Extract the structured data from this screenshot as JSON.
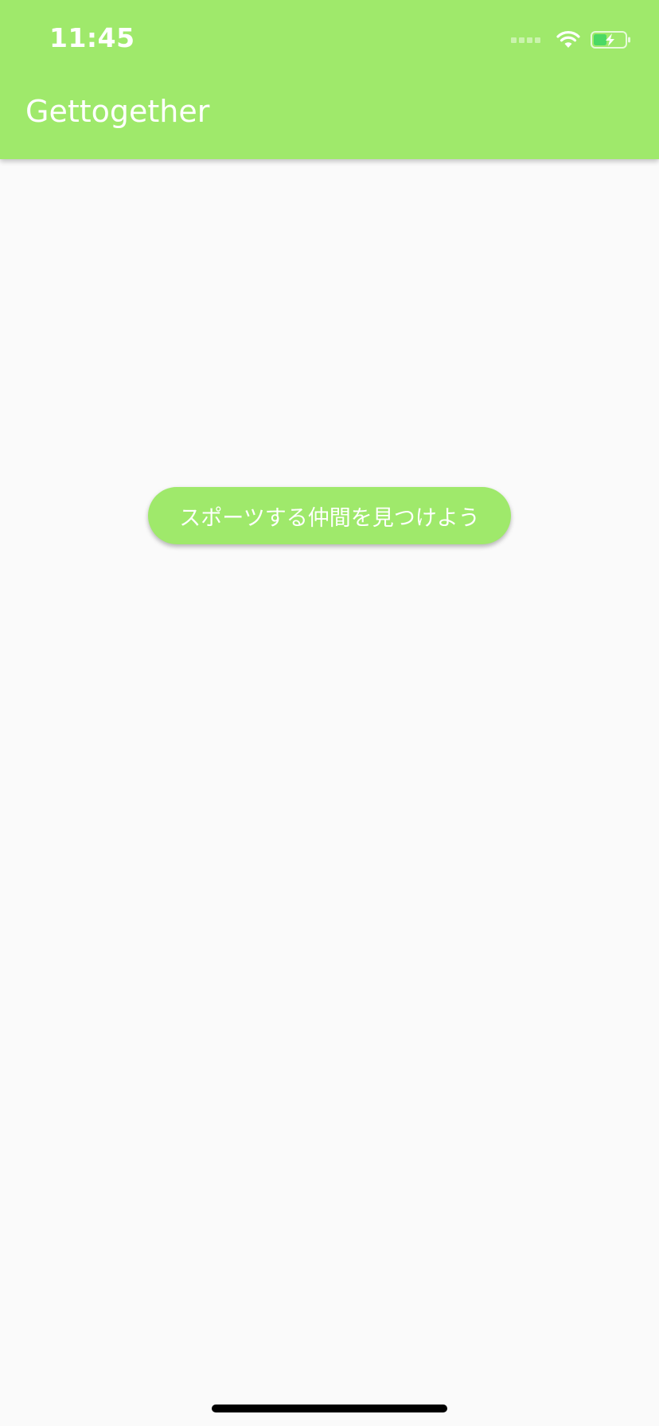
{
  "status_bar": {
    "time": "11:45",
    "icons": [
      "cellular-signal-icon",
      "wifi-icon",
      "battery-charging-icon"
    ]
  },
  "app_bar": {
    "title": "Gettogether"
  },
  "main": {
    "find_button_label": "スポーツする仲間を見つけよう"
  },
  "colors": {
    "accent": "#9fe96b",
    "background": "#fafafa",
    "text_on_accent": "#ffffff"
  }
}
